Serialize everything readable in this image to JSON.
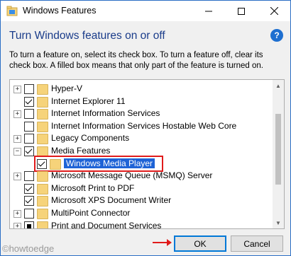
{
  "window": {
    "title": "Windows Features",
    "minimize_label": "—",
    "maximize_label": "☐",
    "close_label": "✕"
  },
  "header": {
    "heading": "Turn Windows features on or off",
    "help_label": "?",
    "description": "To turn a feature on, select its check box. To turn a feature off, clear its check box. A filled box means that only part of the feature is turned on."
  },
  "features": [
    {
      "label": "Hyper-V",
      "expandable": true,
      "state": "unchecked",
      "indent": 0
    },
    {
      "label": "Internet Explorer 11",
      "expandable": false,
      "state": "checked",
      "indent": 0
    },
    {
      "label": "Internet Information Services",
      "expandable": true,
      "state": "unchecked",
      "indent": 0
    },
    {
      "label": "Internet Information Services Hostable Web Core",
      "expandable": false,
      "state": "unchecked",
      "indent": 0
    },
    {
      "label": "Legacy Components",
      "expandable": true,
      "state": "unchecked",
      "indent": 0
    },
    {
      "label": "Media Features",
      "expandable": true,
      "expanded": true,
      "state": "checked",
      "indent": 0
    },
    {
      "label": "Windows Media Player",
      "expandable": false,
      "state": "checked",
      "indent": 1,
      "selected": true
    },
    {
      "label": "Microsoft Message Queue (MSMQ) Server",
      "expandable": true,
      "state": "unchecked",
      "indent": 0
    },
    {
      "label": "Microsoft Print to PDF",
      "expandable": false,
      "state": "checked",
      "indent": 0
    },
    {
      "label": "Microsoft XPS Document Writer",
      "expandable": false,
      "state": "checked",
      "indent": 0
    },
    {
      "label": "MultiPoint Connector",
      "expandable": true,
      "state": "unchecked",
      "indent": 0
    },
    {
      "label": "Print and Document Services",
      "expandable": true,
      "state": "partial",
      "indent": 0
    }
  ],
  "footer": {
    "ok_label": "OK",
    "cancel_label": "Cancel"
  },
  "watermark": "©howtoedge",
  "colors": {
    "heading": "#1a3c8a",
    "selection": "#1e63d6",
    "annotation_red": "#e01b1b",
    "ok_border": "#0078d7"
  }
}
